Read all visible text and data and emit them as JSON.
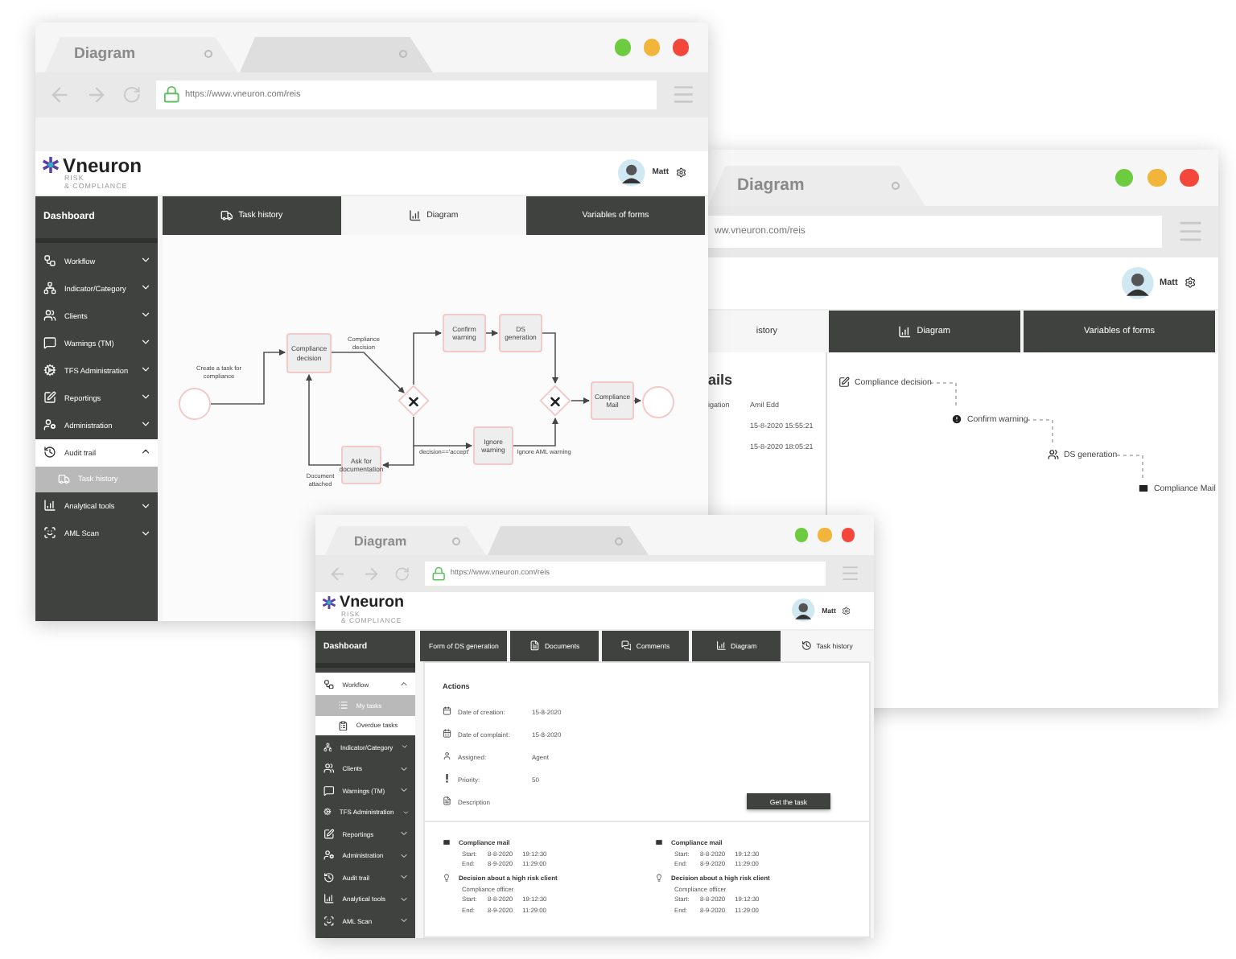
{
  "windows": [
    {
      "kind": "diagram",
      "browser": {
        "tabs": [
          {
            "label": "Diagram",
            "selected": true
          },
          {
            "selected": false
          }
        ],
        "address": "https://www.vneuron.com/reis"
      },
      "logo": {
        "name": "Vneuron",
        "tagline": [
          "RISK",
          "& COMPLIANCE"
        ]
      },
      "user": {
        "name": "Matt"
      },
      "sidebar": {
        "title": "Dashboard",
        "items": [
          {
            "label": "Workflow",
            "expanded": false
          },
          {
            "label": "Indicator/Category",
            "expanded": false
          },
          {
            "label": "Clients",
            "expanded": false
          },
          {
            "label": "Warnings (TM)",
            "expanded": false
          },
          {
            "label": "TFS Administration",
            "expanded": false
          },
          {
            "label": "Reportings",
            "expanded": false
          },
          {
            "label": "Administration",
            "expanded": false
          },
          {
            "label": "Audit trail",
            "expanded": true,
            "children": [
              {
                "label": "Task history",
                "selected": true
              }
            ]
          },
          {
            "label": "Analytical tools",
            "expanded": false
          },
          {
            "label": "AML Scan",
            "expanded": false
          }
        ]
      },
      "tabs": [
        {
          "label": "Task history",
          "selected": false
        },
        {
          "label": "Diagram",
          "selected": true
        },
        {
          "label": "Variables of forms",
          "selected": false
        }
      ],
      "diagram": {
        "nodes": [
          {
            "kind": "start"
          },
          {
            "kind": "task",
            "label": "Compliance decision"
          },
          {
            "kind": "gateway"
          },
          {
            "kind": "task",
            "label": "Confirm warning"
          },
          {
            "kind": "task",
            "label": "DS generation"
          },
          {
            "kind": "gateway"
          },
          {
            "kind": "task",
            "label": "Compliance Mail"
          },
          {
            "kind": "end"
          },
          {
            "kind": "task",
            "label": "Ignore warning"
          },
          {
            "kind": "task",
            "label": "Ask for documentation"
          }
        ],
        "edge_labels": [
          "Create a task for compliance",
          "Compliance decision",
          "decision=='accept'",
          "Ignore AML warning",
          "Document attached"
        ]
      }
    },
    {
      "kind": "history",
      "browser": {
        "tabs": [
          {
            "label": "Diagram",
            "selected": true
          }
        ],
        "address": "ww.vneuron.com/reis"
      },
      "user": {
        "name": "Matt"
      },
      "tabs": [
        {
          "label": "istory",
          "selected": true
        },
        {
          "label": "Diagram",
          "selected": false
        },
        {
          "label": "Variables of forms",
          "selected": false
        }
      ],
      "details": {
        "title": "ails",
        "rows": [
          {
            "label": "igation",
            "value": "Amil Edd"
          },
          {
            "value": "15-8-2020 15:55:21"
          },
          {
            "value": "15-8-2020 18:05:21"
          }
        ]
      },
      "timeline": [
        {
          "kind": "edit",
          "label": "Compliance decision"
        },
        {
          "kind": "alert",
          "label": "Confirm warning"
        },
        {
          "kind": "group",
          "label": "DS generation"
        },
        {
          "kind": "mail",
          "label": "Compliance Mail"
        }
      ]
    },
    {
      "kind": "task",
      "browser": {
        "tabs": [
          {
            "label": "Diagram",
            "selected": true
          },
          {
            "selected": false
          }
        ],
        "address": "https://www.vneuron.com/reis"
      },
      "logo": {
        "name": "Vneuron",
        "tagline": [
          "RISK",
          "& COMPLIANCE"
        ]
      },
      "user": {
        "name": "Matt"
      },
      "sidebar": {
        "title": "Dashboard",
        "items": [
          {
            "label": "Workflow",
            "expanded": true,
            "children": [
              {
                "label": "My tasks",
                "selected": true
              },
              {
                "label": "Overdue tasks",
                "selected": false
              }
            ]
          },
          {
            "label": "Indicator/Category",
            "expanded": false
          },
          {
            "label": "Clients",
            "expanded": false
          },
          {
            "label": "Warnings (TM)",
            "expanded": false
          },
          {
            "label": "TFS Administration",
            "expanded": false
          },
          {
            "label": "Reportings",
            "expanded": false
          },
          {
            "label": "Administration",
            "expanded": false
          },
          {
            "label": "Audit trail",
            "expanded": false
          },
          {
            "label": "Analytical tools",
            "expanded": false
          },
          {
            "label": "AML Scan",
            "expanded": false
          }
        ]
      },
      "tabs": [
        {
          "label": "Form of DS generation",
          "selected": false
        },
        {
          "label": "Documents",
          "selected": false
        },
        {
          "label": "Comments",
          "selected": false
        },
        {
          "label": "Diagram",
          "selected": false
        },
        {
          "label": "Task history",
          "selected": true
        }
      ],
      "actions": {
        "title": "Actions",
        "rows": [
          {
            "label": "Date of creation:",
            "value": "15-8-2020"
          },
          {
            "label": "Date of complaint:",
            "value": "15-8-2020"
          },
          {
            "label": "Assigned:",
            "value": "Agent"
          },
          {
            "label": "Priority:",
            "value": "50"
          },
          {
            "label": "Description"
          }
        ],
        "button": "Get the task"
      },
      "history": [
        {
          "events": [
            {
              "kind": "mail",
              "title": "Compliance mail",
              "lines": [
                {
                  "label": "Start:",
                  "date": "8-8-2020",
                  "time": "19:12:30"
                },
                {
                  "label": "End:",
                  "date": "8-9-2020",
                  "time": "11:29:00"
                }
              ]
            },
            {
              "kind": "decision",
              "title": "Decision about a high risk client",
              "role": "Compliance officer",
              "lines": [
                {
                  "label": "Start:",
                  "date": "8-8-2020",
                  "time": "19:12:30"
                },
                {
                  "label": "End:",
                  "date": "8-9-2020",
                  "time": "11:29:00"
                }
              ]
            }
          ]
        },
        {
          "events": [
            {
              "kind": "mail",
              "title": "Compliance mail",
              "lines": [
                {
                  "label": "Start:",
                  "date": "8-8-2020",
                  "time": "19:12:30"
                },
                {
                  "label": "End:",
                  "date": "8-9-2020",
                  "time": "11:29:00"
                }
              ]
            },
            {
              "kind": "decision",
              "title": "Decision about a high risk client",
              "role": "Compliance officer",
              "lines": [
                {
                  "label": "Start:",
                  "date": "8-8-2020",
                  "time": "19:12:30"
                },
                {
                  "label": "End:",
                  "date": "8-9-2020",
                  "time": "11:29:00"
                }
              ]
            }
          ]
        }
      ]
    }
  ]
}
